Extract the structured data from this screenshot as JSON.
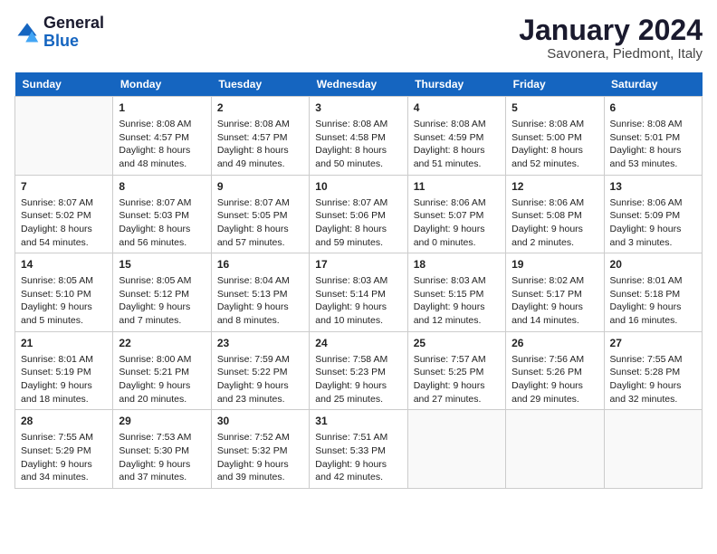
{
  "header": {
    "logo_general": "General",
    "logo_blue": "Blue",
    "month_title": "January 2024",
    "location": "Savonera, Piedmont, Italy"
  },
  "weekdays": [
    "Sunday",
    "Monday",
    "Tuesday",
    "Wednesday",
    "Thursday",
    "Friday",
    "Saturday"
  ],
  "weeks": [
    [
      {
        "day": "",
        "sunrise": "",
        "sunset": "",
        "daylight": ""
      },
      {
        "day": "1",
        "sunrise": "Sunrise: 8:08 AM",
        "sunset": "Sunset: 4:57 PM",
        "daylight": "Daylight: 8 hours and 48 minutes."
      },
      {
        "day": "2",
        "sunrise": "Sunrise: 8:08 AM",
        "sunset": "Sunset: 4:57 PM",
        "daylight": "Daylight: 8 hours and 49 minutes."
      },
      {
        "day": "3",
        "sunrise": "Sunrise: 8:08 AM",
        "sunset": "Sunset: 4:58 PM",
        "daylight": "Daylight: 8 hours and 50 minutes."
      },
      {
        "day": "4",
        "sunrise": "Sunrise: 8:08 AM",
        "sunset": "Sunset: 4:59 PM",
        "daylight": "Daylight: 8 hours and 51 minutes."
      },
      {
        "day": "5",
        "sunrise": "Sunrise: 8:08 AM",
        "sunset": "Sunset: 5:00 PM",
        "daylight": "Daylight: 8 hours and 52 minutes."
      },
      {
        "day": "6",
        "sunrise": "Sunrise: 8:08 AM",
        "sunset": "Sunset: 5:01 PM",
        "daylight": "Daylight: 8 hours and 53 minutes."
      }
    ],
    [
      {
        "day": "7",
        "sunrise": "Sunrise: 8:07 AM",
        "sunset": "Sunset: 5:02 PM",
        "daylight": "Daylight: 8 hours and 54 minutes."
      },
      {
        "day": "8",
        "sunrise": "Sunrise: 8:07 AM",
        "sunset": "Sunset: 5:03 PM",
        "daylight": "Daylight: 8 hours and 56 minutes."
      },
      {
        "day": "9",
        "sunrise": "Sunrise: 8:07 AM",
        "sunset": "Sunset: 5:05 PM",
        "daylight": "Daylight: 8 hours and 57 minutes."
      },
      {
        "day": "10",
        "sunrise": "Sunrise: 8:07 AM",
        "sunset": "Sunset: 5:06 PM",
        "daylight": "Daylight: 8 hours and 59 minutes."
      },
      {
        "day": "11",
        "sunrise": "Sunrise: 8:06 AM",
        "sunset": "Sunset: 5:07 PM",
        "daylight": "Daylight: 9 hours and 0 minutes."
      },
      {
        "day": "12",
        "sunrise": "Sunrise: 8:06 AM",
        "sunset": "Sunset: 5:08 PM",
        "daylight": "Daylight: 9 hours and 2 minutes."
      },
      {
        "day": "13",
        "sunrise": "Sunrise: 8:06 AM",
        "sunset": "Sunset: 5:09 PM",
        "daylight": "Daylight: 9 hours and 3 minutes."
      }
    ],
    [
      {
        "day": "14",
        "sunrise": "Sunrise: 8:05 AM",
        "sunset": "Sunset: 5:10 PM",
        "daylight": "Daylight: 9 hours and 5 minutes."
      },
      {
        "day": "15",
        "sunrise": "Sunrise: 8:05 AM",
        "sunset": "Sunset: 5:12 PM",
        "daylight": "Daylight: 9 hours and 7 minutes."
      },
      {
        "day": "16",
        "sunrise": "Sunrise: 8:04 AM",
        "sunset": "Sunset: 5:13 PM",
        "daylight": "Daylight: 9 hours and 8 minutes."
      },
      {
        "day": "17",
        "sunrise": "Sunrise: 8:03 AM",
        "sunset": "Sunset: 5:14 PM",
        "daylight": "Daylight: 9 hours and 10 minutes."
      },
      {
        "day": "18",
        "sunrise": "Sunrise: 8:03 AM",
        "sunset": "Sunset: 5:15 PM",
        "daylight": "Daylight: 9 hours and 12 minutes."
      },
      {
        "day": "19",
        "sunrise": "Sunrise: 8:02 AM",
        "sunset": "Sunset: 5:17 PM",
        "daylight": "Daylight: 9 hours and 14 minutes."
      },
      {
        "day": "20",
        "sunrise": "Sunrise: 8:01 AM",
        "sunset": "Sunset: 5:18 PM",
        "daylight": "Daylight: 9 hours and 16 minutes."
      }
    ],
    [
      {
        "day": "21",
        "sunrise": "Sunrise: 8:01 AM",
        "sunset": "Sunset: 5:19 PM",
        "daylight": "Daylight: 9 hours and 18 minutes."
      },
      {
        "day": "22",
        "sunrise": "Sunrise: 8:00 AM",
        "sunset": "Sunset: 5:21 PM",
        "daylight": "Daylight: 9 hours and 20 minutes."
      },
      {
        "day": "23",
        "sunrise": "Sunrise: 7:59 AM",
        "sunset": "Sunset: 5:22 PM",
        "daylight": "Daylight: 9 hours and 23 minutes."
      },
      {
        "day": "24",
        "sunrise": "Sunrise: 7:58 AM",
        "sunset": "Sunset: 5:23 PM",
        "daylight": "Daylight: 9 hours and 25 minutes."
      },
      {
        "day": "25",
        "sunrise": "Sunrise: 7:57 AM",
        "sunset": "Sunset: 5:25 PM",
        "daylight": "Daylight: 9 hours and 27 minutes."
      },
      {
        "day": "26",
        "sunrise": "Sunrise: 7:56 AM",
        "sunset": "Sunset: 5:26 PM",
        "daylight": "Daylight: 9 hours and 29 minutes."
      },
      {
        "day": "27",
        "sunrise": "Sunrise: 7:55 AM",
        "sunset": "Sunset: 5:28 PM",
        "daylight": "Daylight: 9 hours and 32 minutes."
      }
    ],
    [
      {
        "day": "28",
        "sunrise": "Sunrise: 7:55 AM",
        "sunset": "Sunset: 5:29 PM",
        "daylight": "Daylight: 9 hours and 34 minutes."
      },
      {
        "day": "29",
        "sunrise": "Sunrise: 7:53 AM",
        "sunset": "Sunset: 5:30 PM",
        "daylight": "Daylight: 9 hours and 37 minutes."
      },
      {
        "day": "30",
        "sunrise": "Sunrise: 7:52 AM",
        "sunset": "Sunset: 5:32 PM",
        "daylight": "Daylight: 9 hours and 39 minutes."
      },
      {
        "day": "31",
        "sunrise": "Sunrise: 7:51 AM",
        "sunset": "Sunset: 5:33 PM",
        "daylight": "Daylight: 9 hours and 42 minutes."
      },
      {
        "day": "",
        "sunrise": "",
        "sunset": "",
        "daylight": ""
      },
      {
        "day": "",
        "sunrise": "",
        "sunset": "",
        "daylight": ""
      },
      {
        "day": "",
        "sunrise": "",
        "sunset": "",
        "daylight": ""
      }
    ]
  ]
}
